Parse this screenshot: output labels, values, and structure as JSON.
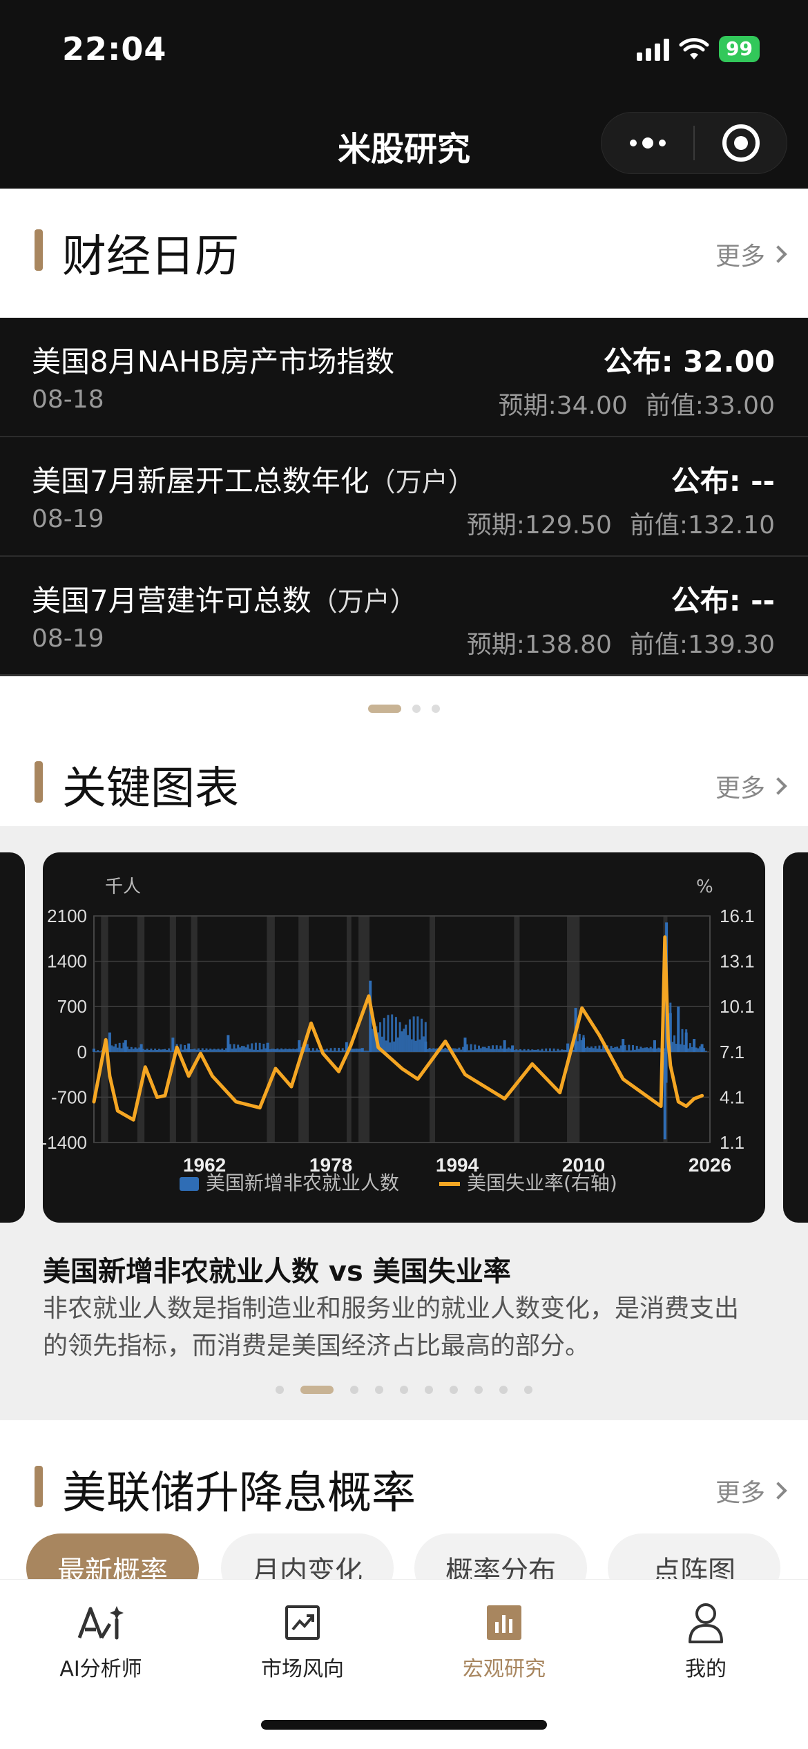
{
  "status_bar": {
    "time": "22:04",
    "battery": "99"
  },
  "nav": {
    "title": "米股研究"
  },
  "calendar": {
    "title": "财经日历",
    "more": "更多",
    "rows": [
      {
        "name": "美国8月NAHB房产市场指数",
        "unit": "",
        "date": "08-18",
        "published": "公布: 32.00",
        "expected": "预期:34.00",
        "previous": "前值:33.00"
      },
      {
        "name": "美国7月新屋开工总数年化",
        "unit": "（万户）",
        "date": "08-19",
        "published": "公布: --",
        "expected": "预期:129.50",
        "previous": "前值:132.10"
      },
      {
        "name": "美国7月营建许可总数",
        "unit": "（万户）",
        "date": "08-19",
        "published": "公布: --",
        "expected": "预期:138.80",
        "previous": "前值:139.30"
      }
    ]
  },
  "key_charts": {
    "title": "关键图表",
    "more": "更多",
    "card_title": "美国新增非农就业人数 vs 美国失业率",
    "card_desc": "非农就业人数是指制造业和服务业的就业人数变化，是消费支出的领先指标，而消费是美国经济占比最高的部分。"
  },
  "chart_data": {
    "type": "line",
    "left_unit": "千人",
    "right_unit": "%",
    "y_left_ticks": [
      "2100",
      "1400",
      "700",
      "0",
      "-700",
      "-1400"
    ],
    "y_right_ticks": [
      "16.1",
      "13.1",
      "10.1",
      "7.1",
      "4.1",
      "1.1"
    ],
    "x_ticks": [
      "1962",
      "1978",
      "1994",
      "2010",
      "2026"
    ],
    "ylim_left": [
      -1400,
      2100
    ],
    "ylim_right": [
      1.1,
      16.1
    ],
    "xlim": [
      1948,
      2026
    ],
    "series": [
      {
        "name": "美国新增非农就业人数",
        "axis": "left",
        "color": "#2f6db5",
        "x": [
          1948,
          1950,
          1952,
          1954,
          1958,
          1960,
          1965,
          1970,
          1974,
          1975,
          1980,
          1982,
          1983,
          1990,
          1995,
          2000,
          2001,
          2008,
          2009,
          2010,
          2015,
          2019,
          2020.3,
          2020.5,
          2021,
          2022,
          2023,
          2024,
          2025
        ],
        "values": [
          50,
          300,
          180,
          120,
          220,
          130,
          260,
          140,
          180,
          120,
          150,
          60,
          1100,
          160,
          220,
          180,
          100,
          130,
          680,
          220,
          200,
          180,
          -1350,
          2000,
          600,
          700,
          300,
          200,
          120
        ]
      },
      {
        "name": "美国失业率(右轴)",
        "axis": "right",
        "color": "#f5a623",
        "x": [
          1948,
          1949.5,
          1950,
          1951,
          1953,
          1954.5,
          1956,
          1957,
          1958.5,
          1960,
          1961.5,
          1963,
          1966,
          1969,
          1971,
          1973,
          1975.5,
          1977,
          1979,
          1980.5,
          1982.8,
          1984,
          1987,
          1989,
          1992.5,
          1995,
          2000,
          2003.5,
          2007,
          2009.8,
          2012,
          2015,
          2019.8,
          2020.3,
          2020.7,
          2021,
          2022,
          2023,
          2024,
          2025
        ],
        "values": [
          3.8,
          7.9,
          5.5,
          3.2,
          2.6,
          6.1,
          4.1,
          4.2,
          7.4,
          5.5,
          7.0,
          5.5,
          3.8,
          3.4,
          6.0,
          4.8,
          9.0,
          7.0,
          5.8,
          7.5,
          10.8,
          7.4,
          6.0,
          5.3,
          7.8,
          5.6,
          4.0,
          6.3,
          4.4,
          10.0,
          8.2,
          5.3,
          3.5,
          14.7,
          8.0,
          6.2,
          3.8,
          3.5,
          4.0,
          4.2
        ]
      }
    ],
    "legend": [
      "美国新增非农就业人数",
      "美国失业率(右轴)"
    ]
  },
  "fed": {
    "title": "美联储升降息概率",
    "more": "更多",
    "tabs": [
      "最新概率",
      "月内变化",
      "概率分布",
      "点阵图"
    ]
  },
  "tabbar": {
    "items": [
      {
        "label": "AI分析师",
        "icon": "ai-icon"
      },
      {
        "label": "市场风向",
        "icon": "trend-chart-icon"
      },
      {
        "label": "宏观研究",
        "icon": "bar-chart-icon"
      },
      {
        "label": "我的",
        "icon": "user-icon"
      }
    ]
  },
  "colors": {
    "accent": "#a8865f",
    "dark_bg": "#121212",
    "series_bar": "#2f6db5",
    "series_line": "#f5a623"
  }
}
